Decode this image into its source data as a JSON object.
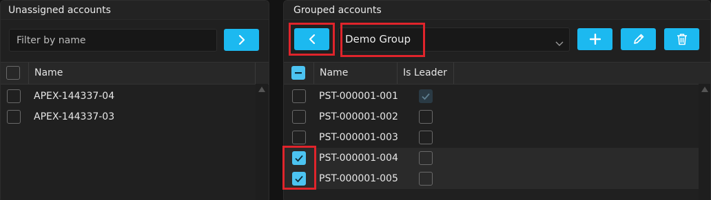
{
  "left_panel": {
    "title": "Unassigned accounts",
    "filter": {
      "placeholder": "Filter by name",
      "value": ""
    },
    "move_button_icon": "chevron-right-icon",
    "columns": [
      "Name"
    ],
    "rows": [
      {
        "name": "APEX-144337-04",
        "checked": false
      },
      {
        "name": "APEX-144337-03",
        "checked": false
      }
    ]
  },
  "right_panel": {
    "title": "Grouped accounts",
    "back_button_icon": "chevron-left-icon",
    "group_select": {
      "value": "Demo Group"
    },
    "toolbar_icons": [
      "plus-icon",
      "pencil-icon",
      "trash-icon"
    ],
    "columns": [
      "Name",
      "Is Leader"
    ],
    "header_checkbox": "indeterminate",
    "rows": [
      {
        "name": "PST-000001-001",
        "checked": false,
        "is_leader": true
      },
      {
        "name": "PST-000001-002",
        "checked": false,
        "is_leader": false
      },
      {
        "name": "PST-000001-003",
        "checked": false,
        "is_leader": false
      },
      {
        "name": "PST-000001-004",
        "checked": true,
        "is_leader": false
      },
      {
        "name": "PST-000001-005",
        "checked": true,
        "is_leader": false
      }
    ]
  },
  "colors": {
    "accent": "#1cb9f0",
    "checkbox_checked": "#4cc3f1",
    "highlight": "#e0242b",
    "background": "#202020"
  }
}
